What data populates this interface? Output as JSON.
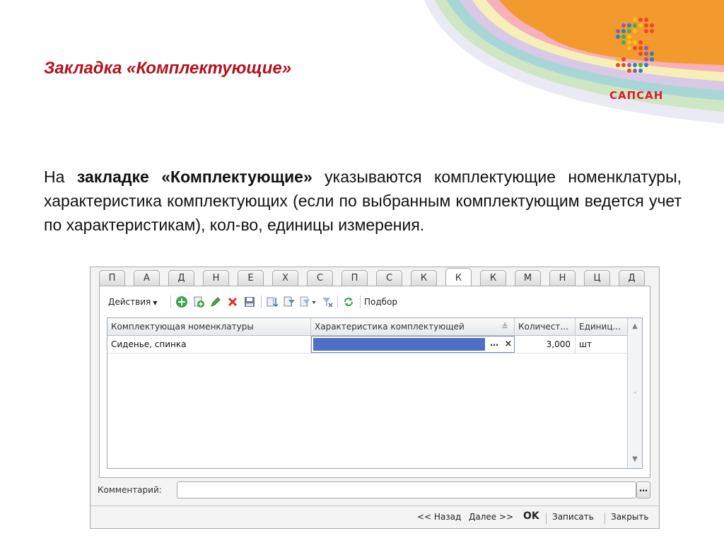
{
  "slide": {
    "title": "Закладка «Комплектующие»",
    "body_prefix": "На ",
    "body_bold": "закладке «Комплектующие»",
    "body_rest": " указываются комплектующие номенклатуры, характеристика комплектующих (если по выбранным комплектующим ведется учет по характеристикам), кол-во, единицы измерения."
  },
  "logo": {
    "brand": "САПСАН"
  },
  "form": {
    "tabs": [
      "П",
      "А",
      "Д",
      "Н",
      "Е",
      "Х",
      "С",
      "П",
      "С",
      "К",
      "К",
      "К",
      "М",
      "Н",
      "Ц",
      "Д"
    ],
    "active_tab_index": 10,
    "toolbar": {
      "actions_label": "Действия",
      "pick_label": "Подбор",
      "icons": [
        "add-icon",
        "copy-icon",
        "edit-icon",
        "delete-icon",
        "save-icon",
        "sort-icon",
        "filter-icon",
        "filter-menu-icon",
        "clear-filter-icon",
        "refresh-icon"
      ]
    },
    "table": {
      "columns": [
        "Комплектующая номенклатуры",
        "Характеристика комплектующей",
        "Количест...",
        "Единиц..."
      ],
      "rows": [
        {
          "item": "Сиденье, спинка",
          "characteristic": "",
          "quantity": "3,000",
          "unit": "шт"
        }
      ]
    },
    "comment": {
      "label": "Комментарий:",
      "value": ""
    },
    "footer": {
      "back": "<< Назад",
      "next": "Далее >>",
      "ok": "OK",
      "write": "Записать",
      "close": "Закрыть"
    }
  },
  "colors": {
    "title": "#b4121f",
    "orange": "#f29a2e",
    "selection": "#4f6fc7",
    "brand_red": "#e01c2b"
  }
}
